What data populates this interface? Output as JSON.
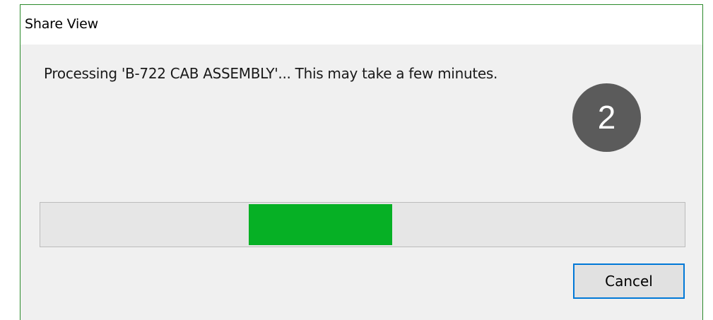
{
  "dialog": {
    "title": "Share View",
    "message": "Processing 'B-722 CAB ASSEMBLY'... This may take a few minutes.",
    "cancel_label": "Cancel"
  },
  "badge": {
    "label": "2"
  },
  "progress": {
    "mode": "indeterminate-marquee",
    "color": "#06b025"
  },
  "colors": {
    "accent": "#0078d7",
    "window_border": "#2b8a2b",
    "badge": "#5b5b5b"
  }
}
